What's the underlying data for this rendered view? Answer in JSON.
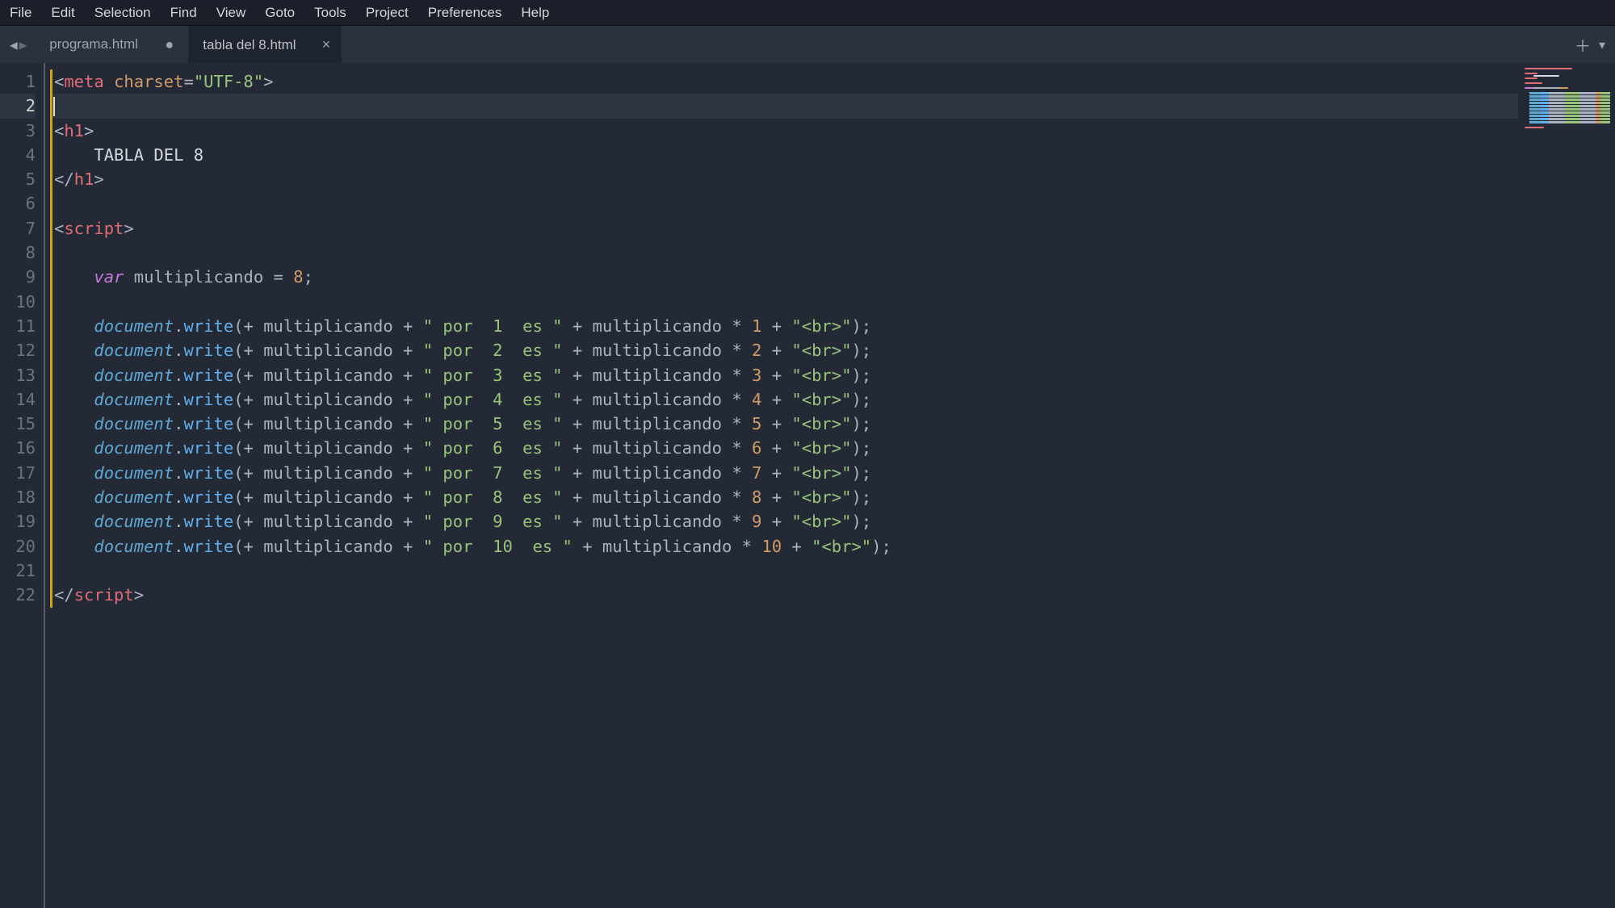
{
  "menu": {
    "items": [
      "File",
      "Edit",
      "Selection",
      "Find",
      "View",
      "Goto",
      "Tools",
      "Project",
      "Preferences",
      "Help"
    ]
  },
  "tabs": {
    "items": [
      {
        "label": "programa.html",
        "active": false,
        "dirty": true
      },
      {
        "label": "tabla del 8.html",
        "active": true,
        "dirty": false
      }
    ]
  },
  "gutter": {
    "lines": [
      "1",
      "2",
      "3",
      "4",
      "5",
      "6",
      "7",
      "8",
      "9",
      "10",
      "11",
      "12",
      "13",
      "14",
      "15",
      "16",
      "17",
      "18",
      "19",
      "20",
      "21",
      "22"
    ],
    "current": 2
  },
  "code": {
    "meta_tag_open": "<",
    "meta_tag_name": "meta",
    "meta_attr_name": "charset",
    "meta_eq": "=",
    "meta_attr_val": "\"UTF-8\"",
    "meta_tag_close": ">",
    "h1_open_lt": "<",
    "h1_name": "h1",
    "h1_open_gt": ">",
    "h1_text": "TABLA DEL 8",
    "h1_close": "</",
    "script_open_lt": "<",
    "script_name": "script",
    "script_open_gt": ">",
    "var_kw": "var",
    "var_name": " multiplicando ",
    "var_eq": "=",
    "var_val": " 8",
    "semicolon": ";",
    "doc_obj": "document",
    "dot": ".",
    "write_fn": "write",
    "paren_open": "(",
    "plus": "+ ",
    "mult_name": "multiplicando ",
    "plus_concat": "+ ",
    "por_label_prefix": "\" por  ",
    "es_label": "  es \"",
    "star": "* ",
    "br_str": "\"<br>\"",
    "paren_close": ")",
    "script_close": "</",
    "lines": [
      {
        "n": "1"
      },
      {
        "n": "2"
      },
      {
        "n": "3"
      },
      {
        "n": "4"
      },
      {
        "n": "5"
      },
      {
        "n": "6"
      },
      {
        "n": "7"
      },
      {
        "n": "8"
      },
      {
        "n": "9"
      },
      {
        "n": "10"
      }
    ]
  }
}
